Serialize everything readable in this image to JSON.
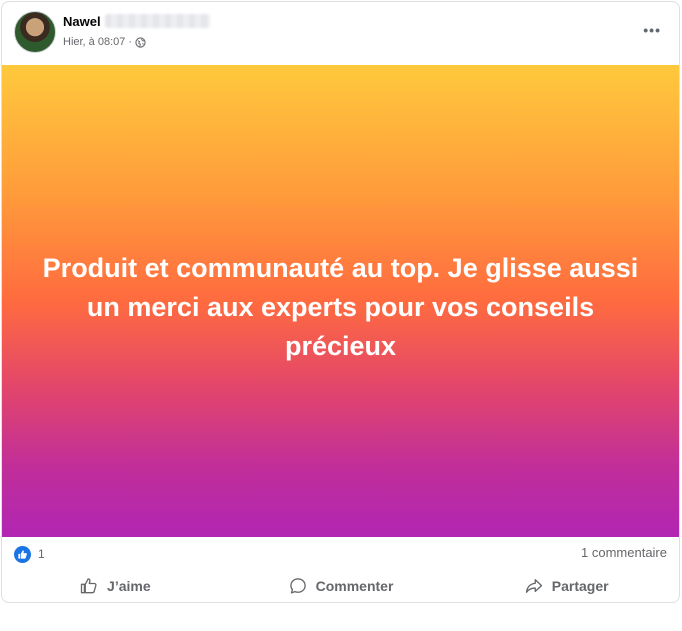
{
  "post": {
    "author_name": "Nawel",
    "meta_time": "Hier, à 08:07 ·",
    "privacy_icon": "globe-icon",
    "more_label": "•••",
    "text": "Produit et communauté au top. Je glisse aussi un merci aux experts pour vos conseils précieux",
    "background_colors": [
      "#ffc93c",
      "#ff6b3f",
      "#b126b3"
    ]
  },
  "stats": {
    "like_count": "1",
    "comments_label": "1 commentaire",
    "like_icon": "thumbs-up-icon"
  },
  "actions": [
    {
      "label": "J’aime",
      "icon": "like-icon"
    },
    {
      "label": "Commenter",
      "icon": "comment-icon"
    },
    {
      "label": "Partager",
      "icon": "share-icon"
    }
  ],
  "colors": {
    "accent": "#1b74e4",
    "muted_text": "#65676b"
  }
}
